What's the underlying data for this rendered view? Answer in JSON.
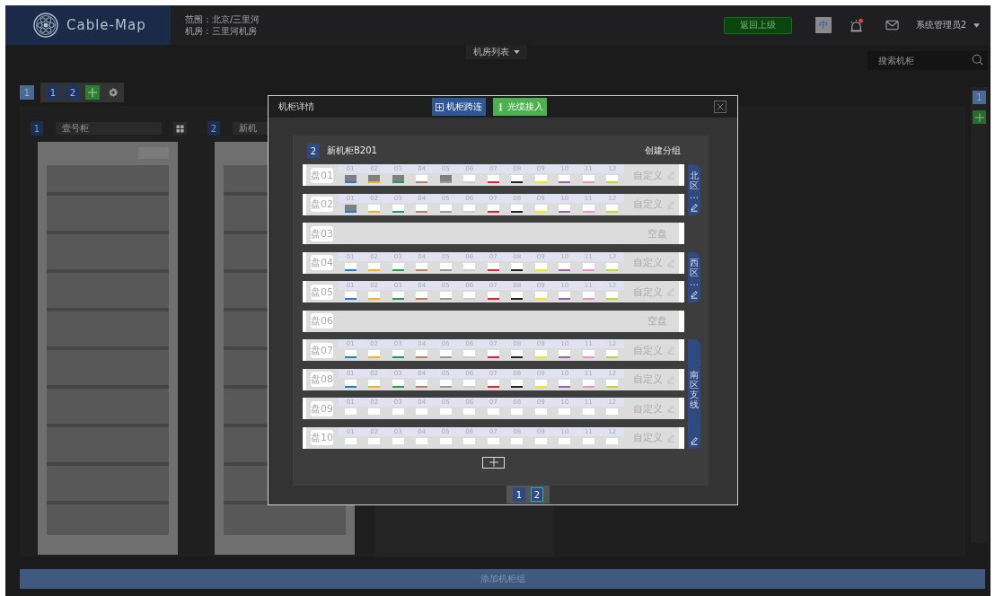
{
  "header": {
    "logo": "Cable-Map",
    "scope": "范围：北京/三里河",
    "room": "机房：三里河机房",
    "back_button": "返回上级",
    "language": "中",
    "alarm": {
      "unread": true
    },
    "user": "系统管理员2"
  },
  "room_dropdown": "机房列表",
  "search": {
    "placeholder": "搜索机柜"
  },
  "room_tab": {
    "label": "1",
    "selected": true
  },
  "cabinet_group_tabs": [
    {
      "label": "1"
    },
    {
      "label": "2"
    }
  ],
  "cabinets": [
    {
      "number": "1",
      "name": "壹号柜"
    },
    {
      "number": "2",
      "name": "新机"
    }
  ],
  "side_tabs": [
    {
      "label": "1"
    }
  ],
  "add_group_button": "添加机柜组",
  "dialog": {
    "title": "机柜详情",
    "buttons": [
      {
        "label": "机柜跨连",
        "kind": "link"
      },
      {
        "label": "光缆接入",
        "kind": "fiber"
      }
    ],
    "cabinet_number": "2",
    "cabinet_name": "新机柜B201",
    "create_group": "创建分组",
    "sections": [
      {
        "group": "北区…",
        "trays": [
          {
            "label": "盘01",
            "kind": "ports",
            "custom": "自定义",
            "ports": [
              {
                "label": "01",
                "used": true,
                "color": "#1a7fd4"
              },
              {
                "label": "02",
                "used": true,
                "color": "#f5b21a"
              },
              {
                "label": "03",
                "used": true,
                "color": "#1aa050"
              },
              {
                "label": "04",
                "used": false,
                "color": "#c08060"
              },
              {
                "label": "05",
                "used": true,
                "color": "#999999"
              },
              {
                "label": "06",
                "used": false,
                "color": "#cccccc"
              },
              {
                "label": "07",
                "used": false,
                "color": "#e8202a"
              },
              {
                "label": "08",
                "used": false,
                "color": "#222222"
              },
              {
                "label": "09",
                "used": false,
                "color": "#f5e51a"
              },
              {
                "label": "10",
                "used": false,
                "color": "#a060b0"
              },
              {
                "label": "11",
                "used": false,
                "color": "#f090c0"
              },
              {
                "label": "12",
                "used": false,
                "color": "#c0d830"
              }
            ]
          },
          {
            "label": "盘02",
            "kind": "ports",
            "custom": "自定义",
            "ports": [
              {
                "label": "01",
                "used": true,
                "color": "#1a7fd4"
              },
              {
                "label": "02",
                "used": false,
                "color": "#f5b21a"
              },
              {
                "label": "03",
                "used": false,
                "color": "#1aa050"
              },
              {
                "label": "04",
                "used": false,
                "color": "#c08060"
              },
              {
                "label": "05",
                "used": false,
                "color": "#999999"
              },
              {
                "label": "06",
                "used": false,
                "color": "#cccccc"
              },
              {
                "label": "07",
                "used": false,
                "color": "#e8202a"
              },
              {
                "label": "08",
                "used": false,
                "color": "#222222"
              },
              {
                "label": "09",
                "used": false,
                "color": "#f5e51a"
              },
              {
                "label": "10",
                "used": false,
                "color": "#a060b0"
              },
              {
                "label": "11",
                "used": false,
                "color": "#f090c0"
              },
              {
                "label": "12",
                "used": false,
                "color": "#c0d830"
              }
            ]
          }
        ]
      },
      {
        "trays": [
          {
            "label": "盘03",
            "kind": "empty",
            "status": "空盘"
          }
        ]
      },
      {
        "group": "西区…",
        "trays": [
          {
            "label": "盘04",
            "kind": "ports",
            "custom": "自定义",
            "ports": [
              {
                "label": "01",
                "used": false,
                "color": "#1a7fd4"
              },
              {
                "label": "02",
                "used": false,
                "color": "#f5b21a"
              },
              {
                "label": "03",
                "used": false,
                "color": "#1aa050"
              },
              {
                "label": "04",
                "used": false,
                "color": "#c08060"
              },
              {
                "label": "05",
                "used": false,
                "color": "#999999"
              },
              {
                "label": "06",
                "used": false,
                "color": "#cccccc"
              },
              {
                "label": "07",
                "used": false,
                "color": "#e8202a"
              },
              {
                "label": "08",
                "used": false,
                "color": "#222222"
              },
              {
                "label": "09",
                "used": false,
                "color": "#f5e51a"
              },
              {
                "label": "10",
                "used": false,
                "color": "#a060b0"
              },
              {
                "label": "11",
                "used": false,
                "color": "#f090c0"
              },
              {
                "label": "12",
                "used": false,
                "color": "#c0d830"
              }
            ]
          },
          {
            "label": "盘05",
            "kind": "ports",
            "custom": "自定义",
            "ports": [
              {
                "label": "01",
                "used": false,
                "color": "#1a7fd4"
              },
              {
                "label": "02",
                "used": false,
                "color": "#f5b21a"
              },
              {
                "label": "03",
                "used": false,
                "color": "#1aa050"
              },
              {
                "label": "04",
                "used": false,
                "color": "#c08060"
              },
              {
                "label": "05",
                "used": false,
                "color": "#999999"
              },
              {
                "label": "06",
                "used": false,
                "color": "#cccccc"
              },
              {
                "label": "07",
                "used": false,
                "color": "#e8202a"
              },
              {
                "label": "08",
                "used": false,
                "color": "#222222"
              },
              {
                "label": "09",
                "used": false,
                "color": "#f5e51a"
              },
              {
                "label": "10",
                "used": false,
                "color": "#a060b0"
              },
              {
                "label": "11",
                "used": false,
                "color": "#f090c0"
              },
              {
                "label": "12",
                "used": false,
                "color": "#c0d830"
              }
            ]
          }
        ]
      },
      {
        "trays": [
          {
            "label": "盘06",
            "kind": "empty",
            "status": "空盘"
          }
        ]
      },
      {
        "group": "南区支线",
        "trays": [
          {
            "label": "盘07",
            "kind": "ports",
            "custom": "自定义",
            "ports": [
              {
                "label": "01",
                "used": false,
                "color": "#1a7fd4"
              },
              {
                "label": "02",
                "used": false,
                "color": "#f5b21a"
              },
              {
                "label": "03",
                "used": false,
                "color": "#1aa050"
              },
              {
                "label": "04",
                "used": false,
                "color": "#c08060"
              },
              {
                "label": "05",
                "used": false,
                "color": "#999999"
              },
              {
                "label": "06",
                "used": false,
                "color": "#cccccc"
              },
              {
                "label": "07",
                "used": false,
                "color": "#e8202a"
              },
              {
                "label": "08",
                "used": false,
                "color": "#222222"
              },
              {
                "label": "09",
                "used": false,
                "color": "#f5e51a"
              },
              {
                "label": "10",
                "used": false,
                "color": "#a060b0"
              },
              {
                "label": "11",
                "used": false,
                "color": "#f090c0"
              },
              {
                "label": "12",
                "used": false,
                "color": "#c0d830"
              }
            ]
          },
          {
            "label": "盘08",
            "kind": "ports",
            "custom": "自定义",
            "ports": [
              {
                "label": "01",
                "used": false,
                "color": "#1a7fd4"
              },
              {
                "label": "02",
                "used": false,
                "color": "#f5b21a"
              },
              {
                "label": "03",
                "used": false,
                "color": "#1aa050"
              },
              {
                "label": "04",
                "used": false,
                "color": "#c08060"
              },
              {
                "label": "05",
                "used": false,
                "color": "#999999"
              },
              {
                "label": "06",
                "used": false,
                "color": "#cccccc"
              },
              {
                "label": "07",
                "used": false,
                "color": "#e8202a"
              },
              {
                "label": "08",
                "used": false,
                "color": "#222222"
              },
              {
                "label": "09",
                "used": false,
                "color": "#f5e51a"
              },
              {
                "label": "10",
                "used": false,
                "color": "#a060b0"
              },
              {
                "label": "11",
                "used": false,
                "color": "#f090c0"
              },
              {
                "label": "12",
                "used": false,
                "color": "#c0d830"
              }
            ]
          },
          {
            "label": "盘09",
            "kind": "ports",
            "custom": "自定义",
            "ports": [
              {
                "label": "01",
                "used": false
              },
              {
                "label": "02",
                "used": false
              },
              {
                "label": "03",
                "used": false
              },
              {
                "label": "04",
                "used": false
              },
              {
                "label": "05",
                "used": false
              },
              {
                "label": "06",
                "used": false
              },
              {
                "label": "07",
                "used": false
              },
              {
                "label": "08",
                "used": false
              },
              {
                "label": "09",
                "used": false
              },
              {
                "label": "10",
                "used": false
              },
              {
                "label": "11",
                "used": false
              },
              {
                "label": "12",
                "used": false
              }
            ]
          },
          {
            "label": "盘10",
            "kind": "ports",
            "custom": "自定义",
            "ports": [
              {
                "label": "01",
                "used": false
              },
              {
                "label": "02",
                "used": false
              },
              {
                "label": "03",
                "used": false
              },
              {
                "label": "04",
                "used": false
              },
              {
                "label": "05",
                "used": false
              },
              {
                "label": "06",
                "used": false
              },
              {
                "label": "07",
                "used": false
              },
              {
                "label": "08",
                "used": false
              },
              {
                "label": "09",
                "used": false
              },
              {
                "label": "10",
                "used": false
              },
              {
                "label": "11",
                "used": false
              },
              {
                "label": "12",
                "used": false
              }
            ]
          }
        ]
      }
    ],
    "pages": [
      {
        "label": "1",
        "selected": false
      },
      {
        "label": "2",
        "selected": true
      }
    ]
  }
}
